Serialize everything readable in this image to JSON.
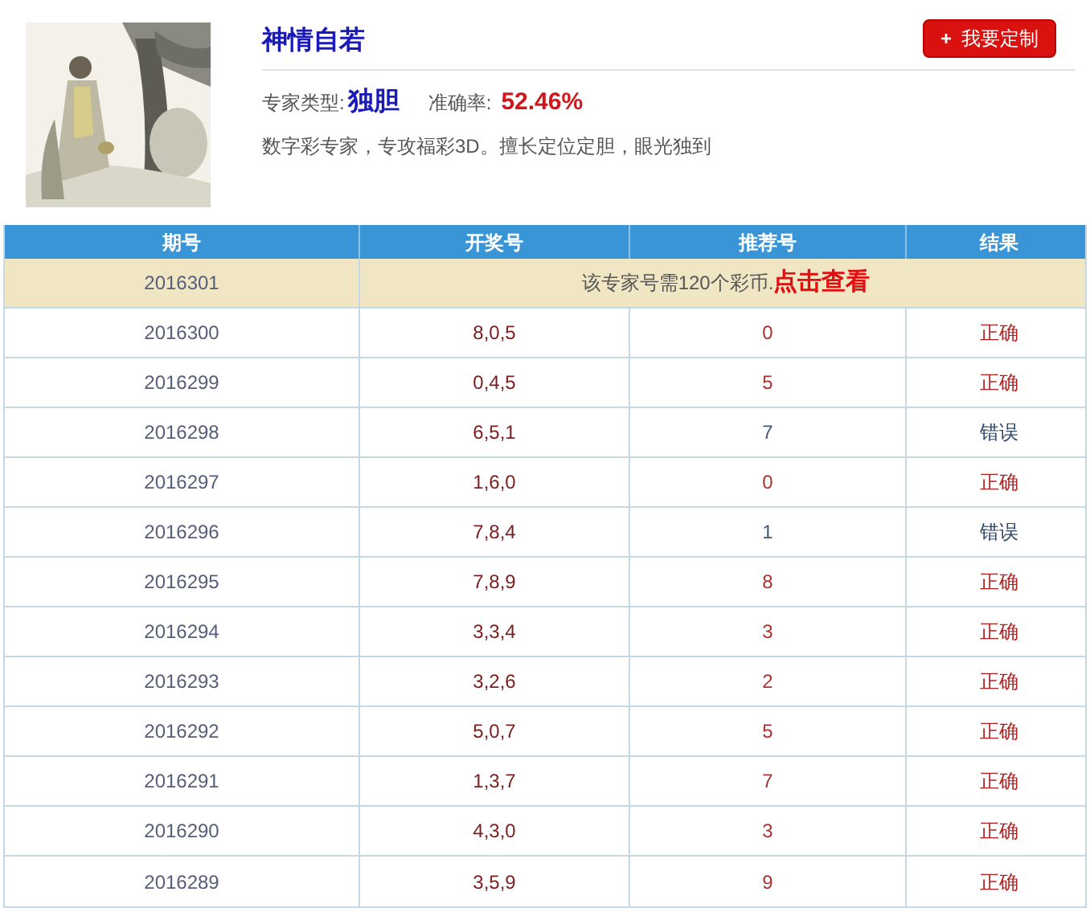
{
  "expert": {
    "name": "神情自若",
    "button": {
      "icon": "+",
      "label": "我要定制"
    },
    "type_label": "专家类型:",
    "type_value": "独胆",
    "accuracy_label": "准确率:",
    "accuracy_value": "52.46%",
    "description": "数字彩专家，专攻福彩3D。擅长定位定胆，眼光独到"
  },
  "table": {
    "columns": [
      "期号",
      "开奖号",
      "推荐号",
      "结果"
    ],
    "pending": {
      "issue": "2016301",
      "notice": "该专家号需120个彩币.",
      "link": "点击查看"
    },
    "rows": [
      {
        "issue": "2016300",
        "draw": "8,0,5",
        "pick": "0",
        "result": "正确",
        "correct": true
      },
      {
        "issue": "2016299",
        "draw": "0,4,5",
        "pick": "5",
        "result": "正确",
        "correct": true
      },
      {
        "issue": "2016298",
        "draw": "6,5,1",
        "pick": "7",
        "result": "错误",
        "correct": false
      },
      {
        "issue": "2016297",
        "draw": "1,6,0",
        "pick": "0",
        "result": "正确",
        "correct": true
      },
      {
        "issue": "2016296",
        "draw": "7,8,4",
        "pick": "1",
        "result": "错误",
        "correct": false
      },
      {
        "issue": "2016295",
        "draw": "7,8,9",
        "pick": "8",
        "result": "正确",
        "correct": true
      },
      {
        "issue": "2016294",
        "draw": "3,3,4",
        "pick": "3",
        "result": "正确",
        "correct": true
      },
      {
        "issue": "2016293",
        "draw": "3,2,6",
        "pick": "2",
        "result": "正确",
        "correct": true
      },
      {
        "issue": "2016292",
        "draw": "5,0,7",
        "pick": "5",
        "result": "正确",
        "correct": true
      },
      {
        "issue": "2016291",
        "draw": "1,3,7",
        "pick": "7",
        "result": "正确",
        "correct": true
      },
      {
        "issue": "2016290",
        "draw": "4,3,0",
        "pick": "3",
        "result": "正确",
        "correct": true
      },
      {
        "issue": "2016289",
        "draw": "3,5,9",
        "pick": "9",
        "result": "正确",
        "correct": true
      }
    ]
  }
}
